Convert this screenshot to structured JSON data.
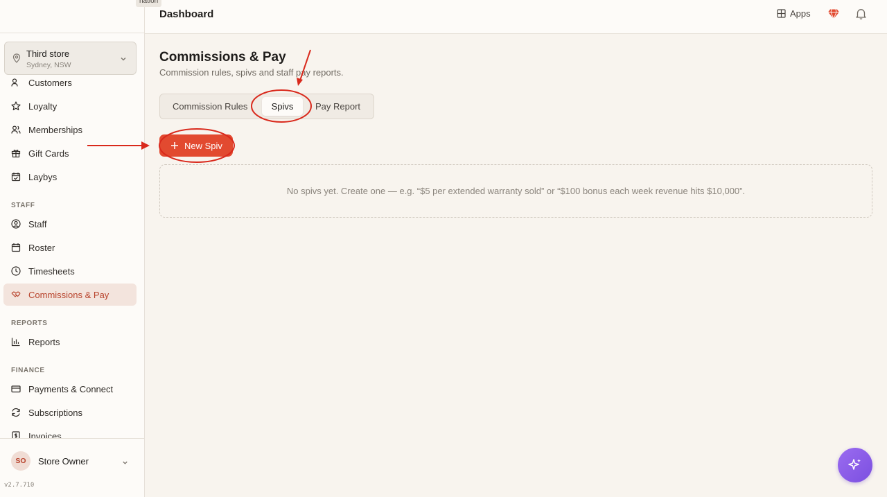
{
  "tooltip_fragment": "nation",
  "header": {
    "title": "Dashboard",
    "apps_label": "Apps",
    "gem_icon": "gem-icon",
    "bell_icon": "bell-icon"
  },
  "store": {
    "name": "Third store",
    "location": "Sydney, NSW"
  },
  "sidebar": {
    "items": [
      {
        "label": "Customers",
        "icon": "users-icon"
      },
      {
        "label": "Loyalty",
        "icon": "star-icon"
      },
      {
        "label": "Memberships",
        "icon": "members-icon"
      },
      {
        "label": "Gift Cards",
        "icon": "gift-icon"
      },
      {
        "label": "Laybys",
        "icon": "calendar-check-icon"
      }
    ],
    "staff_section": "STAFF",
    "staff_items": [
      {
        "label": "Staff",
        "icon": "user-circle-icon"
      },
      {
        "label": "Roster",
        "icon": "calendar-icon"
      },
      {
        "label": "Timesheets",
        "icon": "clock-icon"
      },
      {
        "label": "Commissions & Pay",
        "icon": "handshake-icon",
        "active": true
      }
    ],
    "reports_section": "REPORTS",
    "reports_items": [
      {
        "label": "Reports",
        "icon": "bar-chart-icon"
      }
    ],
    "finance_section": "FINANCE",
    "finance_items": [
      {
        "label": "Payments & Connect",
        "icon": "credit-card-icon"
      },
      {
        "label": "Subscriptions",
        "icon": "refresh-icon"
      },
      {
        "label": "Invoices",
        "icon": "invoice-icon"
      }
    ]
  },
  "user": {
    "initials": "SO",
    "name": "Store Owner"
  },
  "version": "v2.7.710",
  "page": {
    "title": "Commissions & Pay",
    "subtitle": "Commission rules, spivs and staff pay reports.",
    "tabs": [
      {
        "label": "Commission Rules"
      },
      {
        "label": "Spivs",
        "selected": true
      },
      {
        "label": "Pay Report"
      }
    ],
    "new_button": "New Spiv",
    "empty_message": "No spivs yet. Create one — e.g. “$5 per extended warranty sold” or “$100 bonus each week revenue hits $10,000”."
  },
  "colors": {
    "accent": "#e24a30",
    "active_text": "#b8432c",
    "annotation": "#d9291c",
    "fab": "#8a5ce8"
  }
}
